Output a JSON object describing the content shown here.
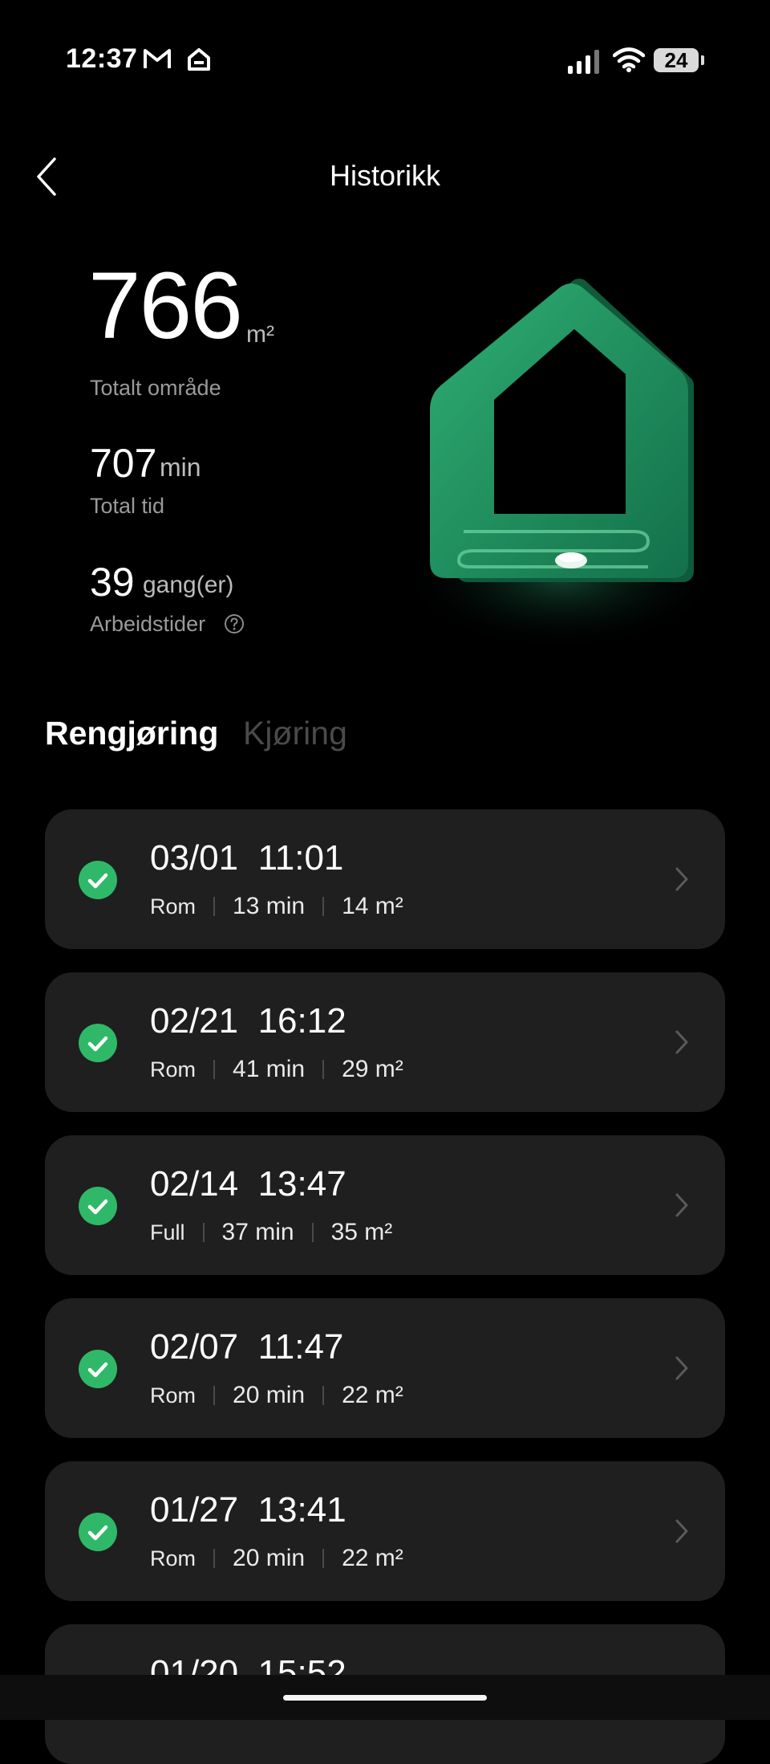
{
  "status_bar": {
    "time": "12:37",
    "icons": [
      "gmail-icon",
      "home-status-icon",
      "signal-icon",
      "wifi-icon"
    ],
    "battery": "24"
  },
  "header": {
    "title": "Historikk",
    "back_icon": "chevron-left-icon"
  },
  "stats": {
    "area": {
      "value": "766",
      "unit": "m²",
      "label": "Totalt område"
    },
    "time": {
      "value": "707",
      "unit": "min",
      "label": "Total tid"
    },
    "count": {
      "value": "39",
      "unit": "gang(er)",
      "label": "Arbeidstider"
    }
  },
  "tabs": [
    {
      "label": "Rengjøring",
      "active": true
    },
    {
      "label": "Kjøring",
      "active": false
    }
  ],
  "records": [
    {
      "date": "03/01",
      "time": "11:01",
      "mode": "Rom",
      "duration": "13 min",
      "area": "14 m²"
    },
    {
      "date": "02/21",
      "time": "16:12",
      "mode": "Rom",
      "duration": "41 min",
      "area": "29 m²"
    },
    {
      "date": "02/14",
      "time": "13:47",
      "mode": "Full",
      "duration": "37 min",
      "area": "35 m²"
    },
    {
      "date": "02/07",
      "time": "11:47",
      "mode": "Rom",
      "duration": "20 min",
      "area": "22 m²"
    },
    {
      "date": "01/27",
      "time": "13:41",
      "mode": "Rom",
      "duration": "20 min",
      "area": "22 m²"
    },
    {
      "date": "01/20",
      "time": "15:52"
    }
  ],
  "colors": {
    "background": "#000000",
    "card": "#1f1f1f",
    "success": "#2fb868",
    "house": "#1f8a5b"
  }
}
